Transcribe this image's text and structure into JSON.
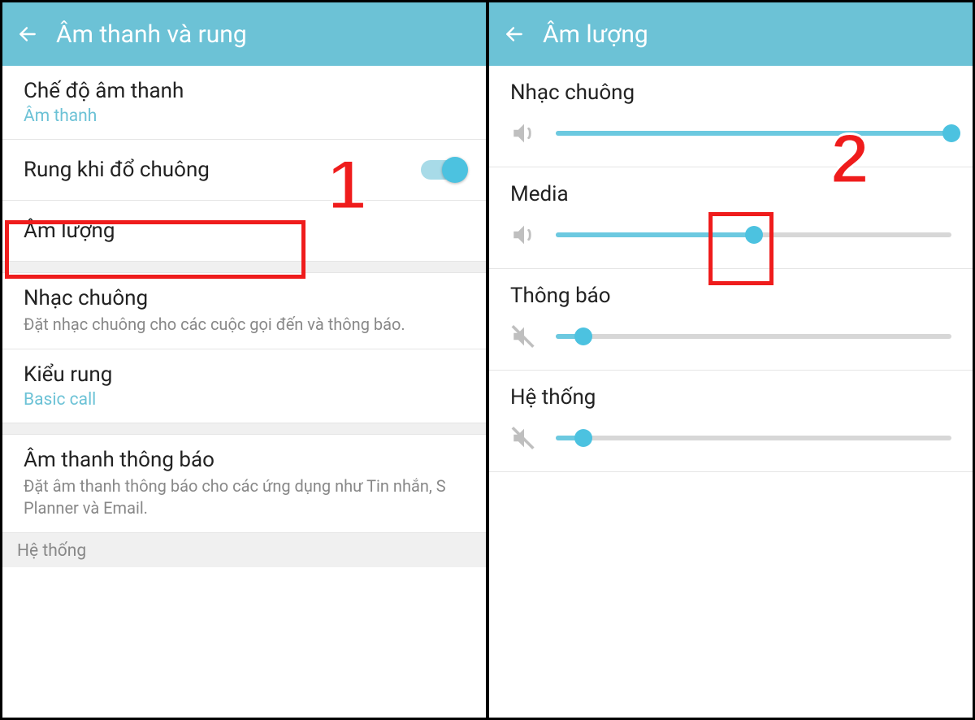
{
  "left": {
    "header_title": "Âm thanh và rung",
    "rows": {
      "sound_mode": {
        "title": "Chế độ âm thanh",
        "value": "Âm thanh"
      },
      "vibrate_ring": {
        "title": "Rung khi đổ chuông"
      },
      "volume": {
        "title": "Âm lượng"
      },
      "ringtone": {
        "title": "Nhạc chuông",
        "desc": "Đặt nhạc chuông cho các cuộc gọi đến và thông báo."
      },
      "vibration_pattern": {
        "title": "Kiểu rung",
        "value": "Basic call"
      },
      "notification_sound": {
        "title": "Âm thanh thông báo",
        "desc": "Đặt âm thanh thông báo cho các ứng dụng như Tin nhắn, S Planner và Email."
      },
      "system_label": "Hệ thống"
    }
  },
  "right": {
    "header_title": "Âm lượng",
    "sliders": {
      "ringtone": {
        "label": "Nhạc chuông",
        "percent": 100,
        "muted": false
      },
      "media": {
        "label": "Media",
        "percent": 50,
        "muted": false
      },
      "notification": {
        "label": "Thông báo",
        "percent": 7,
        "muted": true
      },
      "system": {
        "label": "Hệ thống",
        "percent": 7,
        "muted": true
      }
    }
  },
  "annotations": {
    "num1": "1",
    "num2": "2"
  },
  "colors": {
    "accent": "#6cc2d6",
    "annotation": "#ef1c1c"
  }
}
